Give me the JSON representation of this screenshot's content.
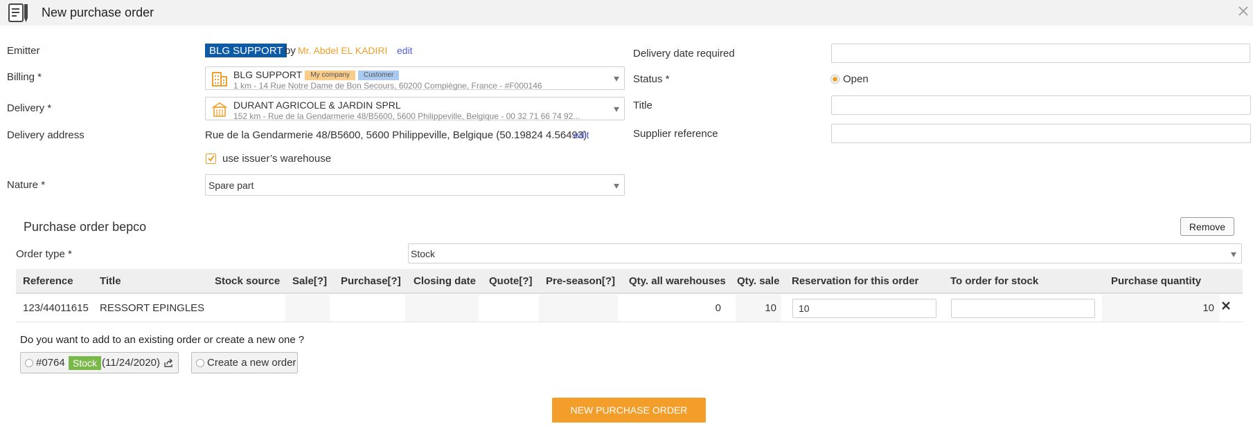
{
  "window": {
    "title": "New purchase order"
  },
  "form": {
    "emitter": {
      "label": "Emitter",
      "company": "BLG SUPPORT",
      "by": "by",
      "person": "Mr. Abdel EL KADIRI",
      "edit": "edit"
    },
    "billing": {
      "label": "Billing *",
      "name": "BLG SUPPORT",
      "badges": [
        "My company",
        "Customer"
      ],
      "detail": "1 km - 14 Rue Notre Dame de Bon Secours, 60200 Compiègne, France - #F000146"
    },
    "delivery": {
      "label": "Delivery *",
      "name": "DURANT AGRICOLE & JARDIN SPRL",
      "detail": "152 km - Rue de la Gendarmerie 48/B5600, 5600 Philippeville, Belgique - 00 32 71 66 74 92..."
    },
    "delivery_address": {
      "label": "Delivery address",
      "value": "Rue de la Gendarmerie 48/B5600, 5600 Philippeville, Belgique (50.19824 4.56493)",
      "edit": "edit"
    },
    "use_warehouse": {
      "label": "use issuer’s warehouse",
      "checked": true
    },
    "nature": {
      "label": "Nature *",
      "value": "Spare part"
    },
    "delivery_date": {
      "label": "Delivery date required",
      "value": ""
    },
    "status": {
      "label": "Status *",
      "value": "Open"
    },
    "title": {
      "label": "Title",
      "value": ""
    },
    "supplier_reference": {
      "label": "Supplier reference",
      "value": ""
    }
  },
  "section": {
    "title": "Purchase order bepco",
    "remove_label": "Remove",
    "order_type": {
      "label": "Order type *",
      "value": "Stock"
    },
    "table": {
      "headers": [
        "Reference",
        "Title",
        "Stock source",
        "Sale",
        "Purchase",
        "Closing date",
        "Quote",
        "Pre-season",
        "Qty. all warehouses",
        "Qty. sale",
        "Reservation for this order",
        "To order for stock",
        "Purchase quantity"
      ],
      "help_marker": "[?]",
      "rows": [
        {
          "reference": "123/44011615",
          "title": "RESSORT EPINGLES",
          "stock_source": "",
          "sale": "",
          "purchase": "",
          "closing_date": "",
          "quote": "",
          "pre_season": "",
          "qty_all_warehouses": "0",
          "qty_sale": "10",
          "reservation": "10",
          "to_order_for_stock": "",
          "purchase_quantity": "10"
        }
      ]
    },
    "question": "Do you want to add to an existing order or create a new one ?",
    "existing_order": {
      "number": "#0764",
      "badge": "Stock",
      "date": "(11/24/2020)"
    },
    "new_order_label": "Create a new order"
  },
  "submit_label": "NEW PURCHASE ORDER",
  "colors": {
    "accent": "#f39d2b",
    "emitter_tag": "#0d5aa7",
    "stock_badge": "#7bb84a",
    "link": "#4f5fd6"
  }
}
